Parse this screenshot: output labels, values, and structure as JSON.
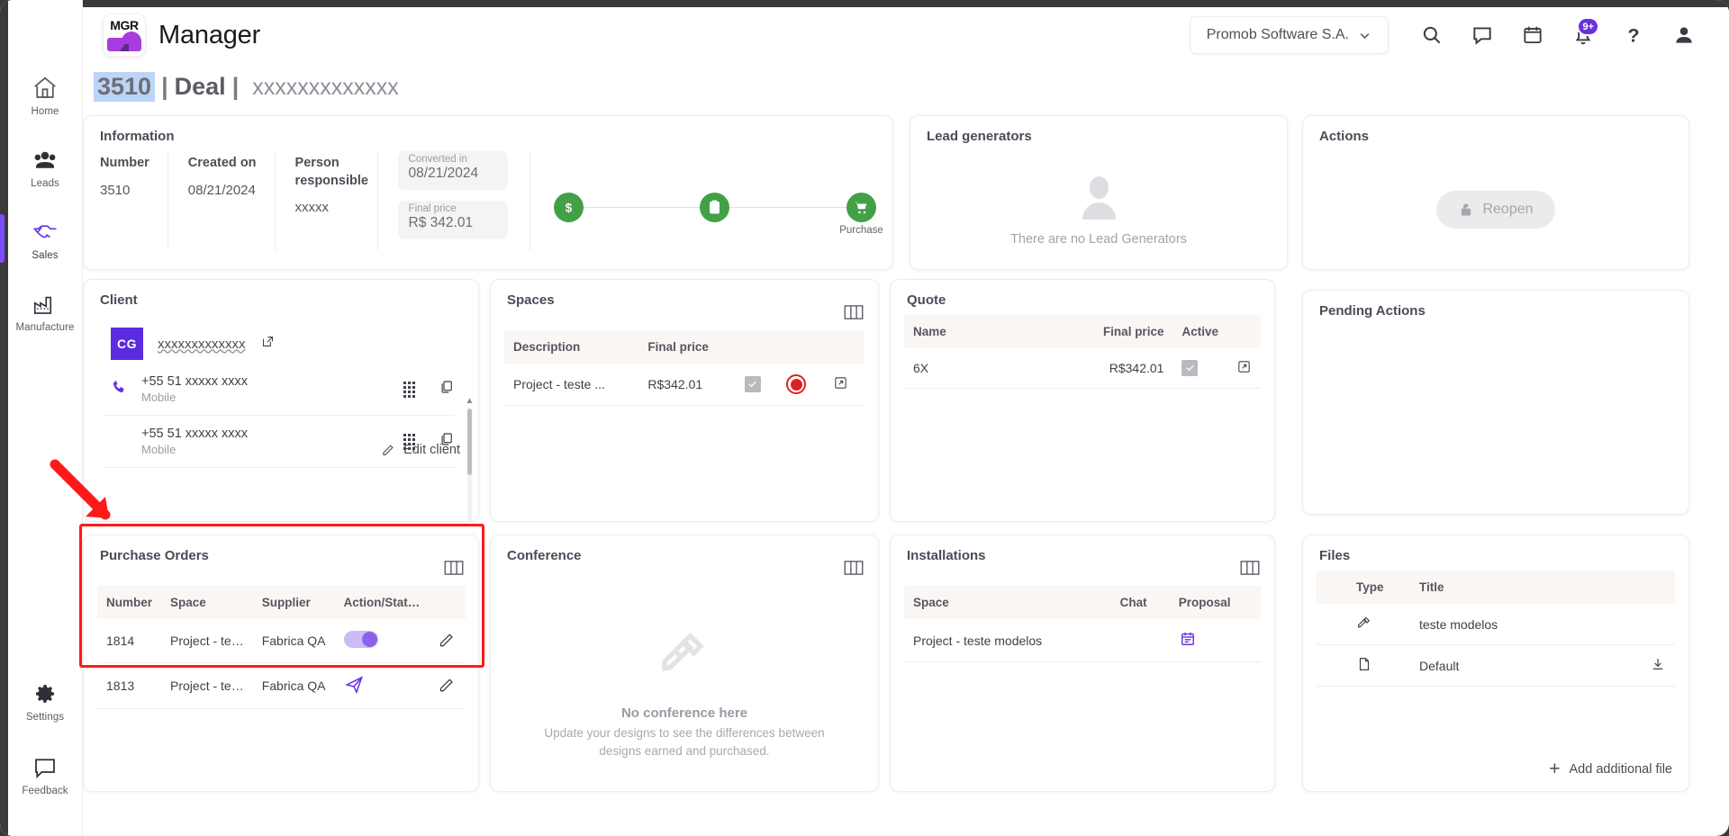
{
  "header": {
    "brand_title": "Manager",
    "logo_text": "MGR",
    "org_name": "Promob Software S.A.",
    "notification_badge": "9+",
    "icons": [
      "search-icon",
      "chat-icon",
      "calendar-icon",
      "bell-icon",
      "help-icon",
      "account-icon"
    ]
  },
  "sidebar": {
    "items": [
      {
        "label": "Home",
        "icon": "home-icon",
        "active": false
      },
      {
        "label": "Leads",
        "icon": "people-icon",
        "active": false
      },
      {
        "label": "Sales",
        "icon": "handshake-icon",
        "active": true
      },
      {
        "label": "Manufacture",
        "icon": "factory-icon",
        "active": false
      }
    ],
    "bottom": [
      {
        "label": "Settings",
        "icon": "gear-icon"
      },
      {
        "label": "Feedback",
        "icon": "feedback-icon"
      }
    ]
  },
  "page_title": {
    "number": "3510",
    "separator": "|",
    "entity": "Deal",
    "client": "xxxxxxxxxxxxx"
  },
  "information": {
    "title": "Information",
    "columns": [
      {
        "label": "Number",
        "value": "3510"
      },
      {
        "label": "Created on",
        "value": "08/21/2024"
      },
      {
        "label": "Person responsible",
        "value": "xxxxx"
      }
    ],
    "fields": [
      {
        "label": "Converted in",
        "value": "08/21/2024"
      },
      {
        "label": "Final price",
        "value": "R$ 342.01"
      }
    ],
    "steps": [
      {
        "label": "",
        "icon": "dollar-icon",
        "done": true
      },
      {
        "label": "",
        "icon": "clipboard-icon",
        "done": true
      },
      {
        "label": "Purchase",
        "icon": "cart-icon",
        "done": true
      }
    ]
  },
  "lead_generators": {
    "title": "Lead generators",
    "empty_text": "There are no Lead Generators"
  },
  "actions": {
    "title": "Actions",
    "reopen_label": "Reopen"
  },
  "pending_actions": {
    "title": "Pending Actions"
  },
  "client": {
    "title": "Client",
    "avatar_initials": "CG",
    "name": "xxxxxxxxxxxxx",
    "phones": [
      {
        "number": "+55 51 xxxxx xxxx",
        "type": "Mobile"
      },
      {
        "number": "+55 51 xxxxx xxxx",
        "type": "Mobile"
      }
    ],
    "edit_label": "Edit client"
  },
  "spaces": {
    "title": "Spaces",
    "headers": [
      "Description",
      "Final price",
      "",
      "",
      ""
    ],
    "rows": [
      {
        "description": "Project - teste ...",
        "final_price": "R$342.01",
        "checked": true,
        "status_icon": "globe-red-icon",
        "open_icon": "external-link-icon"
      }
    ]
  },
  "quote": {
    "title": "Quote",
    "headers": [
      "Name",
      "Final price",
      "Active",
      ""
    ],
    "rows": [
      {
        "name": "6X",
        "final_price": "R$342.01",
        "active": true,
        "open_icon": "external-link-icon"
      }
    ]
  },
  "purchase_orders": {
    "title": "Purchase Orders",
    "headers": [
      "Number",
      "Space",
      "Supplier",
      "Action/Stat…",
      ""
    ],
    "rows": [
      {
        "number": "1814",
        "space": "Project - te…",
        "supplier": "Fabrica QA",
        "action_icon": "toggle-on-icon",
        "edit_icon": "pencil-icon"
      },
      {
        "number": "1813",
        "space": "Project - te…",
        "supplier": "Fabrica QA",
        "action_icon": "send-plane-icon",
        "edit_icon": "pencil-icon"
      }
    ]
  },
  "conference": {
    "title": "Conference",
    "empty_title": "No conference here",
    "empty_subtitle": "Update your designs to see the differences between designs earned and purchased."
  },
  "installations": {
    "title": "Installations",
    "headers": [
      "Space",
      "Chat",
      "Proposal"
    ],
    "rows": [
      {
        "space": "Project - teste modelos",
        "chat": "",
        "proposal_icon": "calendar-purple-icon"
      }
    ]
  },
  "files": {
    "title": "Files",
    "headers": [
      "",
      "Type",
      "Title",
      ""
    ],
    "rows": [
      {
        "type_icon": "tools-icon",
        "title": "teste modelos",
        "action_icon": ""
      },
      {
        "type_icon": "pdf-icon",
        "title": "Default",
        "action_icon": "download-icon"
      }
    ],
    "add_label": "Add additional file"
  },
  "colors": {
    "accent_purple": "#6a30e0",
    "success_green": "#43a047",
    "annotation_red": "#ff1a1a",
    "table_header_bg": "#faf6f3"
  }
}
